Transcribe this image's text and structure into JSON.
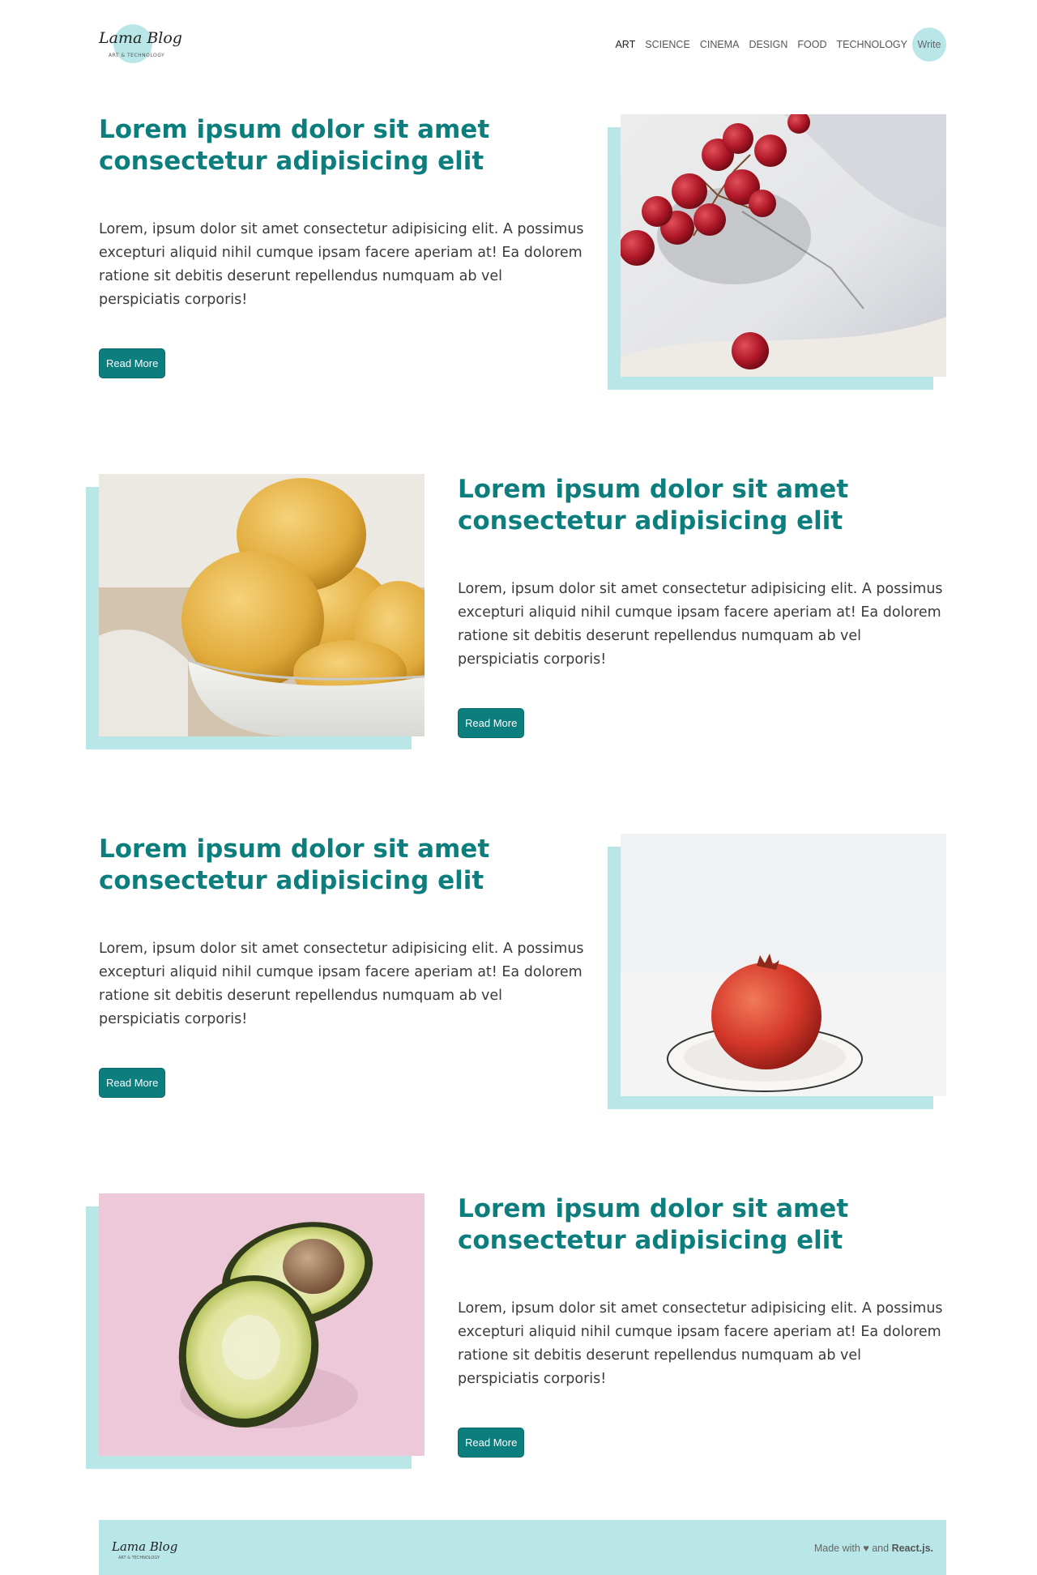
{
  "logo": {
    "title": "Lama Blog",
    "subtitle": "ART & TECHNOLOGY"
  },
  "nav": {
    "links": [
      "ART",
      "SCIENCE",
      "CINEMA",
      "DESIGN",
      "FOOD",
      "TECHNOLOGY"
    ],
    "write_label": "Write"
  },
  "posts": [
    {
      "title": "Lorem ipsum dolor sit amet consectetur adipisicing elit",
      "desc": "Lorem, ipsum dolor sit amet consectetur adipisicing elit. A possimus excepturi aliquid nihil cumque ipsam facere aperiam at! Ea dolorem ratione sit debitis deserunt repellendus numquam ab vel perspiciatis corporis!",
      "button": "Read More",
      "image": "grapes-photo"
    },
    {
      "title": "Lorem ipsum dolor sit amet consectetur adipisicing elit",
      "desc": "Lorem, ipsum dolor sit amet consectetur adipisicing elit. A possimus excepturi aliquid nihil cumque ipsam facere aperiam at! Ea dolorem ratione sit debitis deserunt repellendus numquam ab vel perspiciatis corporis!",
      "button": "Read More",
      "image": "lemons-photo"
    },
    {
      "title": "Lorem ipsum dolor sit amet consectetur adipisicing elit",
      "desc": "Lorem, ipsum dolor sit amet consectetur adipisicing elit. A possimus excepturi aliquid nihil cumque ipsam facere aperiam at! Ea dolorem ratione sit debitis deserunt repellendus numquam ab vel perspiciatis corporis!",
      "button": "Read More",
      "image": "pomegranate-photo"
    },
    {
      "title": "Lorem ipsum dolor sit amet consectetur adipisicing elit",
      "desc": "Lorem, ipsum dolor sit amet consectetur adipisicing elit. A possimus excepturi aliquid nihil cumque ipsam facere aperiam at! Ea dolorem ratione sit debitis deserunt repellendus numquam ab vel perspiciatis corporis!",
      "button": "Read More",
      "image": "avocado-photo"
    }
  ],
  "footer": {
    "logo_title": "Lama Blog",
    "logo_subtitle": "ART & TECHNOLOGY",
    "made_with": "Made with",
    "heart": "♥",
    "and": "and",
    "tech": "React.js."
  },
  "colors": {
    "accent": "#0d7e7e",
    "light_accent": "#b9e7e7"
  }
}
